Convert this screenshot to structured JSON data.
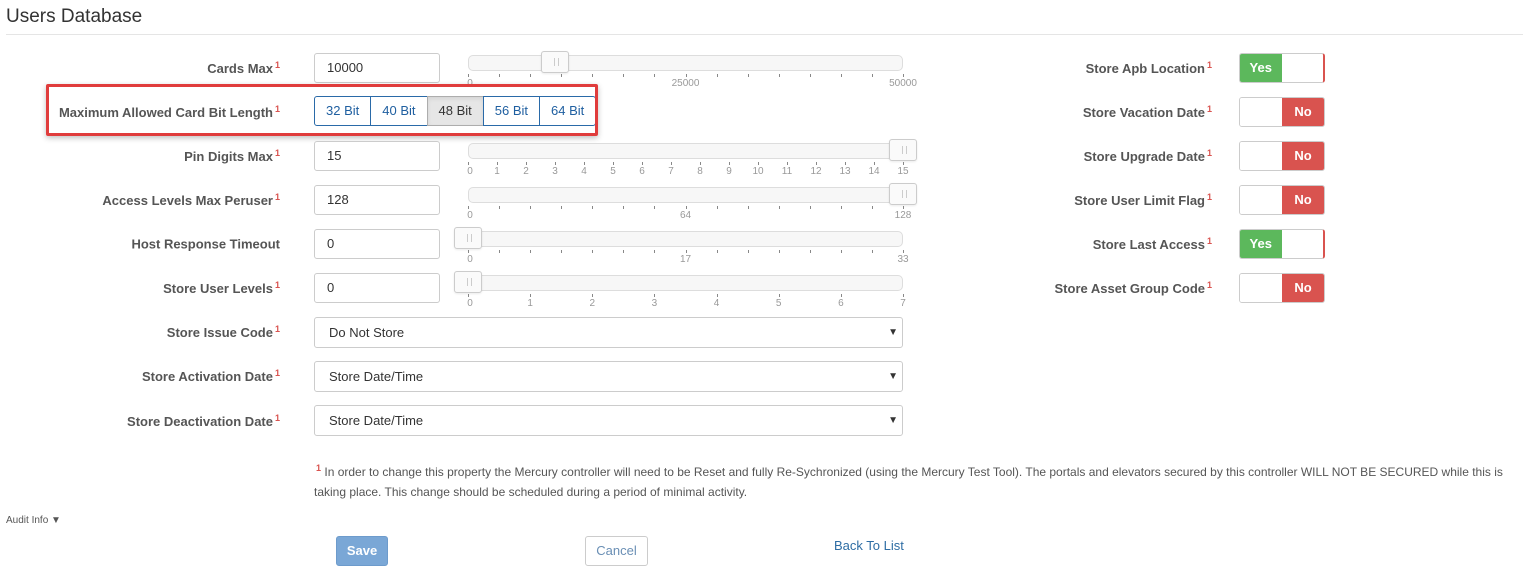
{
  "title": "Users Database",
  "required_marker": "1",
  "fields": {
    "cards_max": {
      "label": "Cards Max",
      "value": "10000",
      "slider": {
        "min": 0,
        "max": 50000,
        "value": 10000,
        "tick_labels": [
          "0",
          "25000",
          "50000"
        ]
      }
    },
    "bit_length": {
      "label": "Maximum Allowed Card Bit Length",
      "options": [
        "32 Bit",
        "40 Bit",
        "48 Bit",
        "56 Bit",
        "64 Bit"
      ],
      "selected": "48 Bit"
    },
    "pin_digits": {
      "label": "Pin Digits Max",
      "value": "15",
      "slider": {
        "min": 0,
        "max": 15,
        "value": 15,
        "tick_labels": [
          "0",
          "1",
          "2",
          "3",
          "4",
          "5",
          "6",
          "7",
          "8",
          "9",
          "10",
          "11",
          "12",
          "13",
          "14",
          "15"
        ]
      }
    },
    "access_levels": {
      "label": "Access Levels Max Peruser",
      "value": "128",
      "slider": {
        "min": 0,
        "max": 128,
        "value": 128,
        "tick_labels": [
          "0",
          "64",
          "128"
        ]
      }
    },
    "host_timeout": {
      "label": "Host Response Timeout",
      "value": "0",
      "slider": {
        "min": 0,
        "max": 33,
        "value": 0,
        "tick_labels": [
          "0",
          "17",
          "33"
        ]
      }
    },
    "store_user_levels": {
      "label": "Store User Levels",
      "value": "0",
      "slider": {
        "min": 0,
        "max": 7,
        "value": 0,
        "tick_labels": [
          "0",
          "1",
          "2",
          "3",
          "4",
          "5",
          "6",
          "7"
        ]
      }
    },
    "store_issue_code": {
      "label": "Store Issue Code",
      "value": "Do Not Store"
    },
    "store_activation_date": {
      "label": "Store Activation Date",
      "value": "Store Date/Time"
    },
    "store_deactivation_date": {
      "label": "Store Deactivation Date",
      "value": "Store Date/Time"
    }
  },
  "toggles": [
    {
      "label": "Store Apb Location",
      "state": "Yes"
    },
    {
      "label": "Store Vacation Date",
      "state": "No"
    },
    {
      "label": "Store Upgrade Date",
      "state": "No"
    },
    {
      "label": "Store User Limit Flag",
      "state": "No"
    },
    {
      "label": "Store Last Access",
      "state": "Yes"
    },
    {
      "label": "Store Asset Group Code",
      "state": "No"
    }
  ],
  "footnote": {
    "marker": "1",
    "text": "In order to change this property the Mercury controller will need to be Reset and fully Re-Sychronized (using the Mercury Test Tool). The portals and elevators secured by this controller WILL NOT BE SECURED while this is taking place. This change should be scheduled during a period of minimal activity."
  },
  "audit_info": "Audit Info",
  "buttons": {
    "save": "Save",
    "cancel": "Cancel",
    "back": "Back To List"
  },
  "colors": {
    "yes": "#5cb85c",
    "no": "#d9534f",
    "highlight": "#e03c3c",
    "link": "#2e6da4"
  }
}
